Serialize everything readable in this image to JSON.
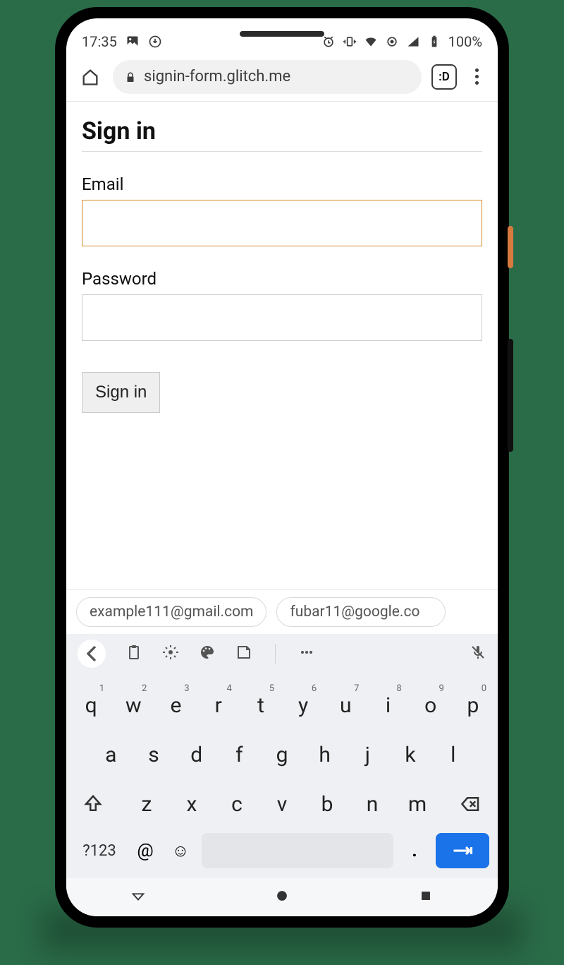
{
  "statusbar": {
    "time": "17:35",
    "battery": "100%"
  },
  "browser": {
    "url": "signin-form.glitch.me",
    "tab_count": ":D"
  },
  "page": {
    "title": "Sign in",
    "email_label": "Email",
    "password_label": "Password",
    "signin_button": "Sign in"
  },
  "suggestions": {
    "items": [
      "example111@gmail.com",
      "fubar11@google.co"
    ]
  },
  "keyboard": {
    "row1": [
      {
        "k": "q",
        "n": "1"
      },
      {
        "k": "w",
        "n": "2"
      },
      {
        "k": "e",
        "n": "3"
      },
      {
        "k": "r",
        "n": "4"
      },
      {
        "k": "t",
        "n": "5"
      },
      {
        "k": "y",
        "n": "6"
      },
      {
        "k": "u",
        "n": "7"
      },
      {
        "k": "i",
        "n": "8"
      },
      {
        "k": "o",
        "n": "9"
      },
      {
        "k": "p",
        "n": "0"
      }
    ],
    "row2": [
      "a",
      "s",
      "d",
      "f",
      "g",
      "h",
      "j",
      "k",
      "l"
    ],
    "row3": [
      "z",
      "x",
      "c",
      "v",
      "b",
      "n",
      "m"
    ],
    "sym": "?123",
    "at": "@",
    "dot": "."
  }
}
